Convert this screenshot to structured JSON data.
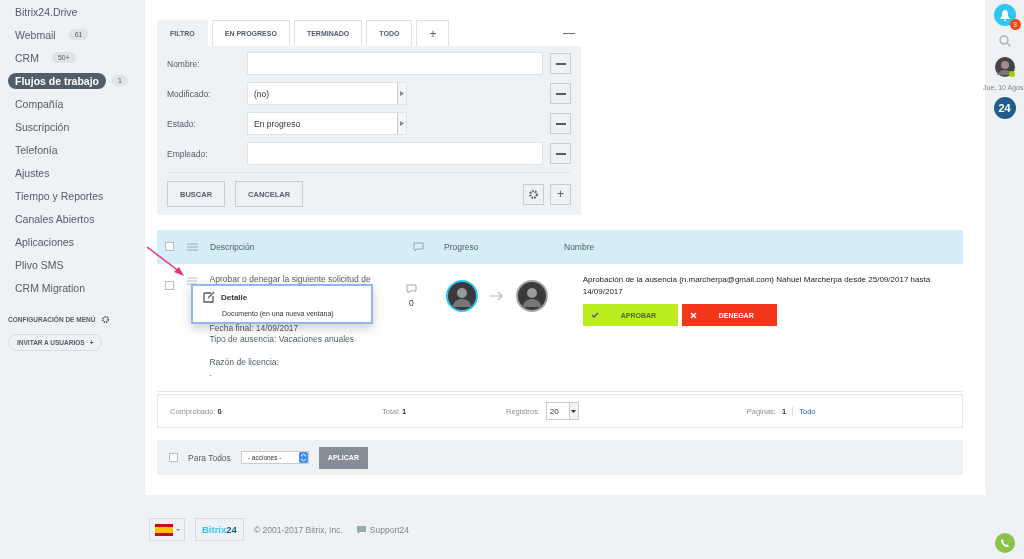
{
  "sidebar": {
    "items": [
      {
        "label": "Bitrix24.Drive",
        "selected": false
      },
      {
        "label": "Webmail",
        "count": "61",
        "selected": false
      },
      {
        "label": "CRM",
        "count": "50+",
        "selected": false
      },
      {
        "label": "Flujos de trabajo",
        "count": "1",
        "selected": true
      },
      {
        "label": "Compañía",
        "selected": false
      },
      {
        "label": "Suscripción",
        "selected": false
      },
      {
        "label": "Telefonía",
        "selected": false
      },
      {
        "label": "Ajustes",
        "selected": false
      },
      {
        "label": "Tiempo y Reportes",
        "selected": false
      },
      {
        "label": "Canales Abiertos",
        "selected": false
      },
      {
        "label": "Aplicaciones",
        "selected": false
      },
      {
        "label": "Plivo SMS",
        "selected": false
      },
      {
        "label": "CRM Migration",
        "selected": false
      }
    ],
    "menu_settings": "CONFIGURACIÓN DE MENÚ",
    "invite": "INVITAR A USUARIOS",
    "invite_plus": "+"
  },
  "filter": {
    "tabs": [
      {
        "label": "FILTRO",
        "selected": true
      },
      {
        "label": "EN PROGRESO",
        "selected": false
      },
      {
        "label": "TERMINADO",
        "selected": false
      },
      {
        "label": "TODO",
        "selected": false
      }
    ],
    "add_tab": "+",
    "collapse": "—",
    "fields": [
      {
        "label": "Nombre:",
        "kind": "text"
      },
      {
        "label": "Modificado:",
        "kind": "select",
        "value": "(no)"
      },
      {
        "label": "Estado:",
        "kind": "select",
        "value": "En progreso"
      },
      {
        "label": "Empleado:",
        "kind": "text"
      }
    ],
    "buttons": [
      "BUSCAR",
      "CANCELAR"
    ],
    "add": "+"
  },
  "table": {
    "header_checked": false,
    "columns": [
      "Descripción",
      "Progreso",
      "Nombre"
    ],
    "rows": [
      {
        "checked": false,
        "description": [
          [
            "Aprobar o denegar la siguiente solicitud de"
          ],
          [
            "Fecha final: 14/09/2017",
            "Tipo de ausencia: Vacaciones anuales"
          ],
          [
            "Razón de licencia:",
            "."
          ]
        ],
        "comments": "0",
        "name": "Aprobación de la ausencia (n.marcherpa@gmail.com) Nahuel Marcherpa desde 25/09/2017 hasta 14/09/2017",
        "approve": "APROBAR",
        "deny": "DENEGAR"
      }
    ],
    "context_menu": [
      {
        "label": "Detalle",
        "kind": "header"
      },
      {
        "label": "Documento (en una nueva ventana)",
        "kind": "item"
      }
    ]
  },
  "pager": {
    "checked_label": "Comprobado:",
    "checked_value": "0",
    "total_label": "Total:",
    "total_value": "1",
    "records_label": "Registros:",
    "records_value": "20",
    "pages_label": "Páginas:",
    "pages_value": "1",
    "all": "Todo"
  },
  "actions": {
    "for_all": "Para Todos",
    "checked": false,
    "select": "- acciones -",
    "apply": "APLICAR"
  },
  "footer": {
    "logo_text": "Bitrix",
    "logo_num": "24",
    "copyright": "© 2001-2017 Bitrix, Inc.",
    "support": "Support24"
  },
  "rail": {
    "notifications": "3",
    "date": "Jue, 10 Agos",
    "badge": "24"
  }
}
